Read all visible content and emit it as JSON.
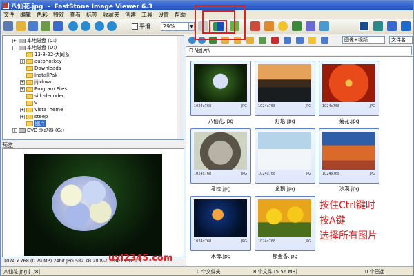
{
  "window": {
    "title": "八仙花.jpg  -  FastStone Image Viewer 6.3"
  },
  "menu": [
    "文件",
    "编辑",
    "色彩",
    "特效",
    "查看",
    "标签",
    "收藏夹",
    "创建",
    "工具",
    "设置",
    "帮助"
  ],
  "toolbar": {
    "smooth_label": "平滑",
    "zoom_value": "29%"
  },
  "tree": [
    {
      "label": "本地磁盘 (C:)",
      "indent": 1,
      "type": "drive",
      "expander": "+"
    },
    {
      "label": "本地磁盘 (D:)",
      "indent": 1,
      "type": "drive",
      "expander": "-"
    },
    {
      "label": "13-8-22-大同系",
      "indent": 2,
      "type": "folder",
      "expander": ""
    },
    {
      "label": "autohotkey",
      "indent": 2,
      "type": "folder",
      "expander": "+"
    },
    {
      "label": "Downloads",
      "indent": 2,
      "type": "folder",
      "expander": ""
    },
    {
      "label": "InstallPak",
      "indent": 2,
      "type": "folder",
      "expander": ""
    },
    {
      "label": "jijidown",
      "indent": 2,
      "type": "folder",
      "expander": "+"
    },
    {
      "label": "Program Files",
      "indent": 2,
      "type": "folder",
      "expander": "+"
    },
    {
      "label": "silk-decoder",
      "indent": 2,
      "type": "folder",
      "expander": ""
    },
    {
      "label": "v",
      "indent": 2,
      "type": "folder",
      "expander": ""
    },
    {
      "label": "VistaTheme",
      "indent": 2,
      "type": "folder",
      "expander": "+"
    },
    {
      "label": "steep",
      "indent": 2,
      "type": "folder",
      "expander": "+"
    },
    {
      "label": "图片",
      "indent": 2,
      "type": "folder",
      "expander": "",
      "selected": true
    },
    {
      "label": "DVD 驱动器 (G:)",
      "indent": 1,
      "type": "drive",
      "expander": "+"
    }
  ],
  "preview": {
    "label": "预览",
    "status": "1024 x 768 (0.79 MP)  24bit  JPG  582 KB  2009-07-14 13:32  1:1"
  },
  "browser": {
    "address": "D:\\图片\\",
    "sort": "图像+视频",
    "filter": "文件名"
  },
  "thumbnails": [
    {
      "name": "八仙花.jpg",
      "dims": "1024x768",
      "ext": "JPG",
      "img": "img-hydrangea"
    },
    {
      "name": "灯塔.jpg",
      "dims": "1024x768",
      "ext": "JPG",
      "img": "img-lighthouse"
    },
    {
      "name": "菊花.jpg",
      "dims": "1024x768",
      "ext": "JPG",
      "img": "img-chrysanthemum"
    },
    {
      "name": "考拉.jpg",
      "dims": "1024x768",
      "ext": "JPG",
      "img": "img-koala"
    },
    {
      "name": "企鹅.jpg",
      "dims": "1024x768",
      "ext": "JPG",
      "img": "img-penguins"
    },
    {
      "name": "沙漠.jpg",
      "dims": "1024x768",
      "ext": "JPG",
      "img": "img-desert"
    },
    {
      "name": "水母.jpg",
      "dims": "1024x768",
      "ext": "JPG",
      "img": "img-jellyfish"
    },
    {
      "name": "郁金香.jpg",
      "dims": "1024x768",
      "ext": "JPG",
      "img": "img-tulips"
    }
  ],
  "annotation": [
    "按住Ctrl键时",
    "按A键",
    "选择所有图片"
  ],
  "watermark": "uxl2345.com",
  "status": {
    "file": "八仙花.jpg [1/8]",
    "folders": "0 个文件夹",
    "files": "8 个文件 (5.56 MB)",
    "selected": "0 个已选"
  }
}
